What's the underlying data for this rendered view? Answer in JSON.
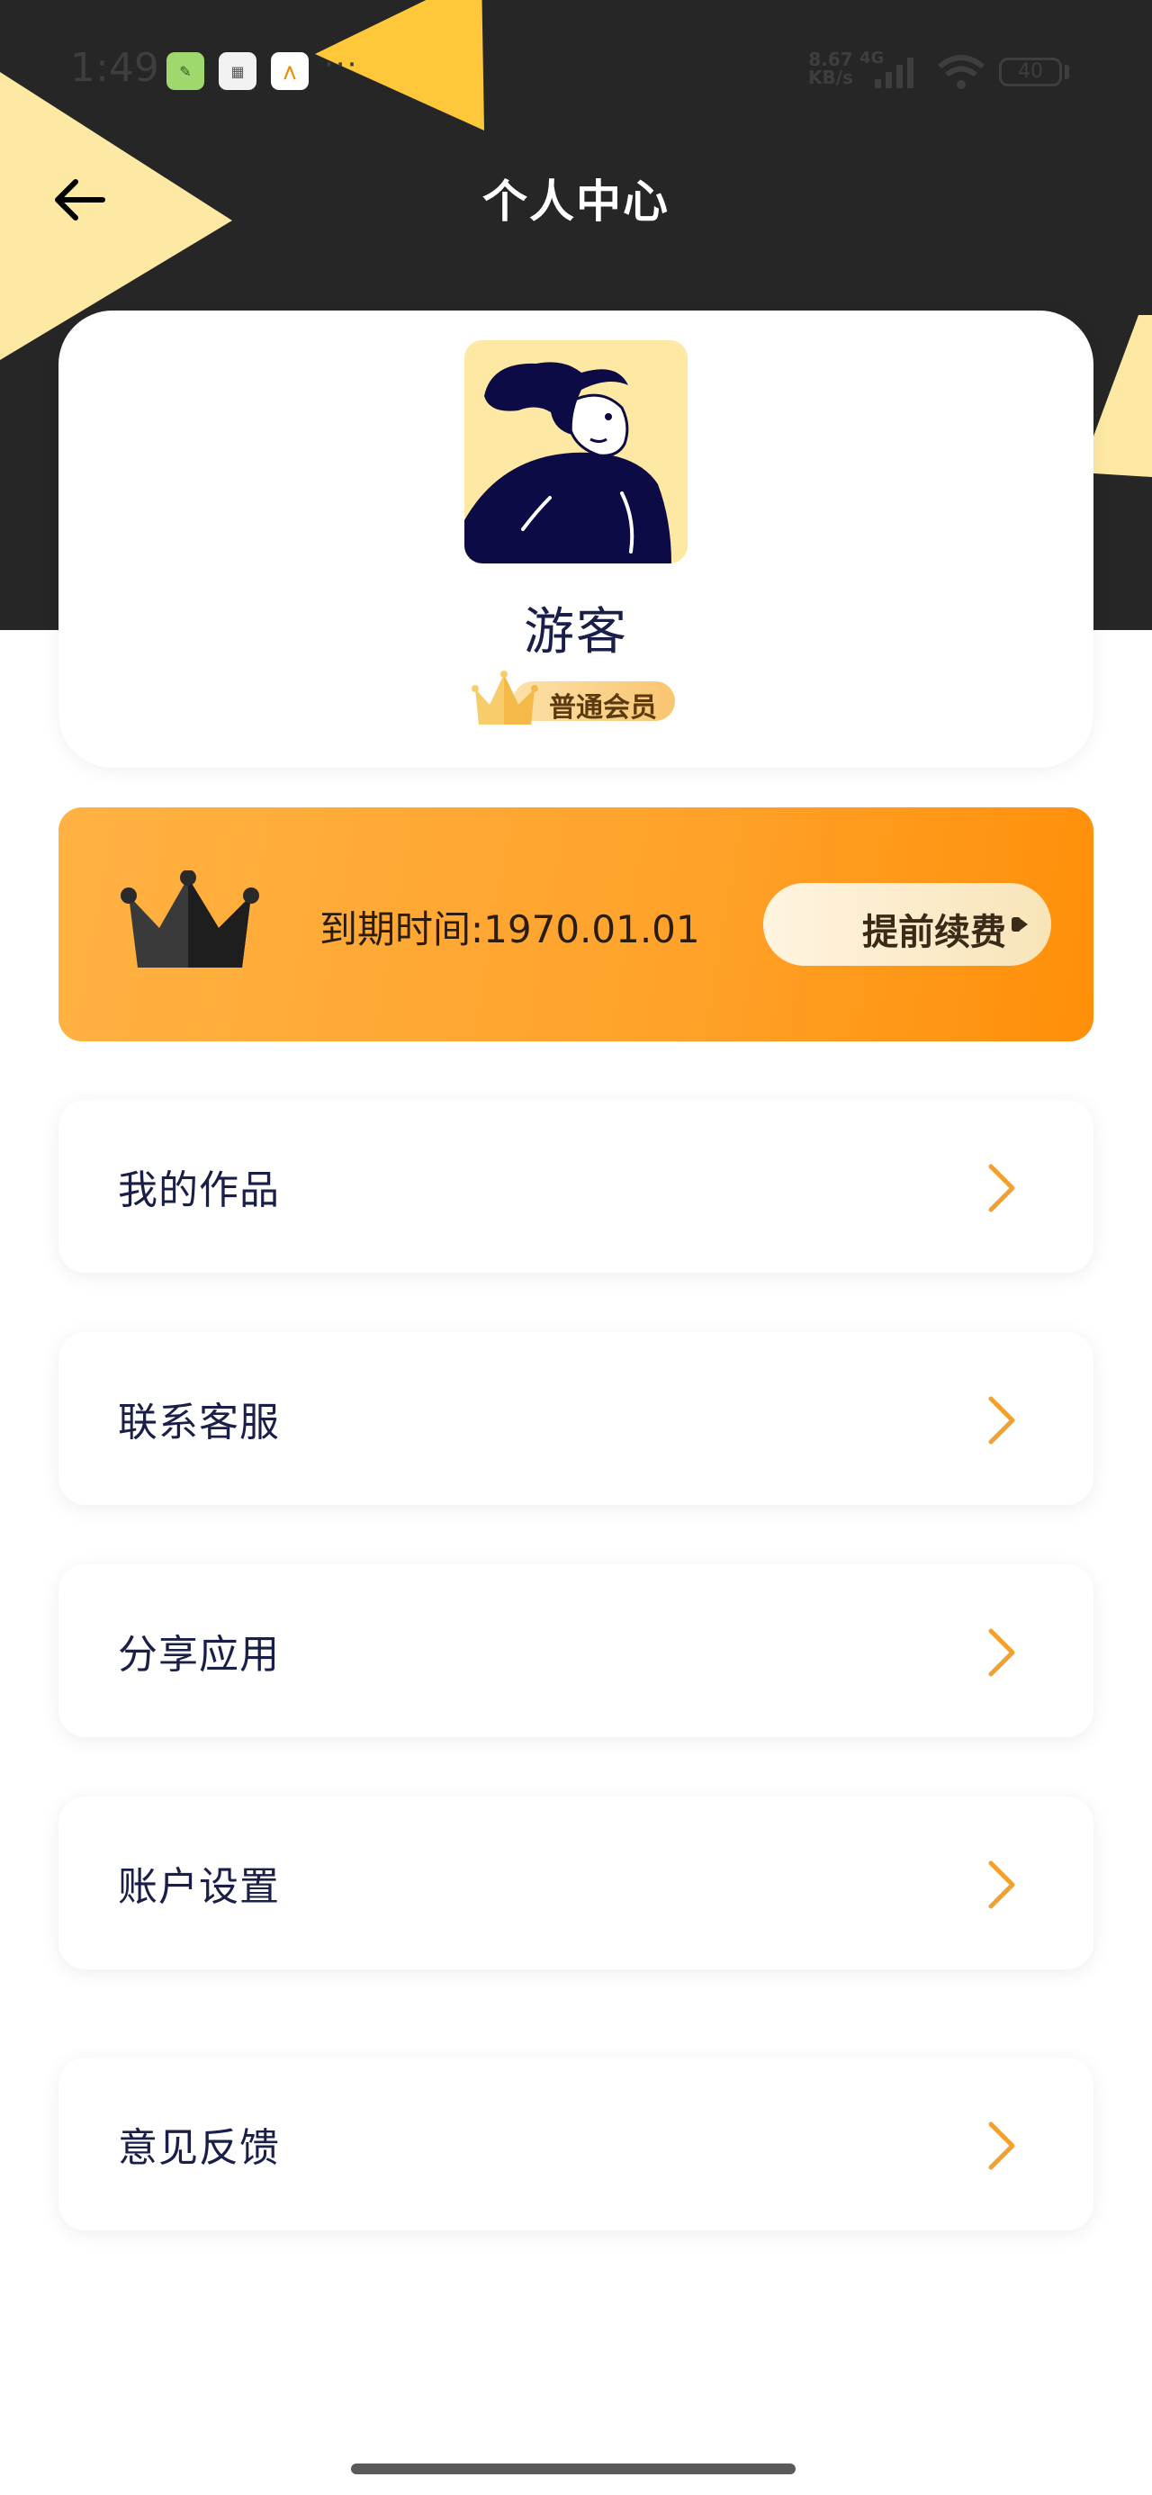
{
  "status_bar": {
    "time": "1:49",
    "net_speed_value": "8.67",
    "net_speed_unit": "KB/s",
    "network_type": "4G",
    "battery": "40",
    "overflow": "···"
  },
  "header": {
    "title": "个人中心"
  },
  "profile": {
    "username": "游客",
    "membership": "普通会员"
  },
  "vip": {
    "expire_text": "到期时间:1970.01.01",
    "renew_label": "提前续费"
  },
  "menu": {
    "items": [
      {
        "label": "我的作品"
      },
      {
        "label": "联系客服"
      },
      {
        "label": "分享应用"
      },
      {
        "label": "账户设置"
      },
      {
        "label": "意见反馈"
      }
    ]
  },
  "colors": {
    "header_bg": "#262626",
    "accent_orange": "#ff9a1a",
    "chevron": "#f3a12e",
    "text_dark": "#1a1f4a",
    "deco_yellow_light": "#fde9a4",
    "deco_yellow": "#ffc83a"
  }
}
